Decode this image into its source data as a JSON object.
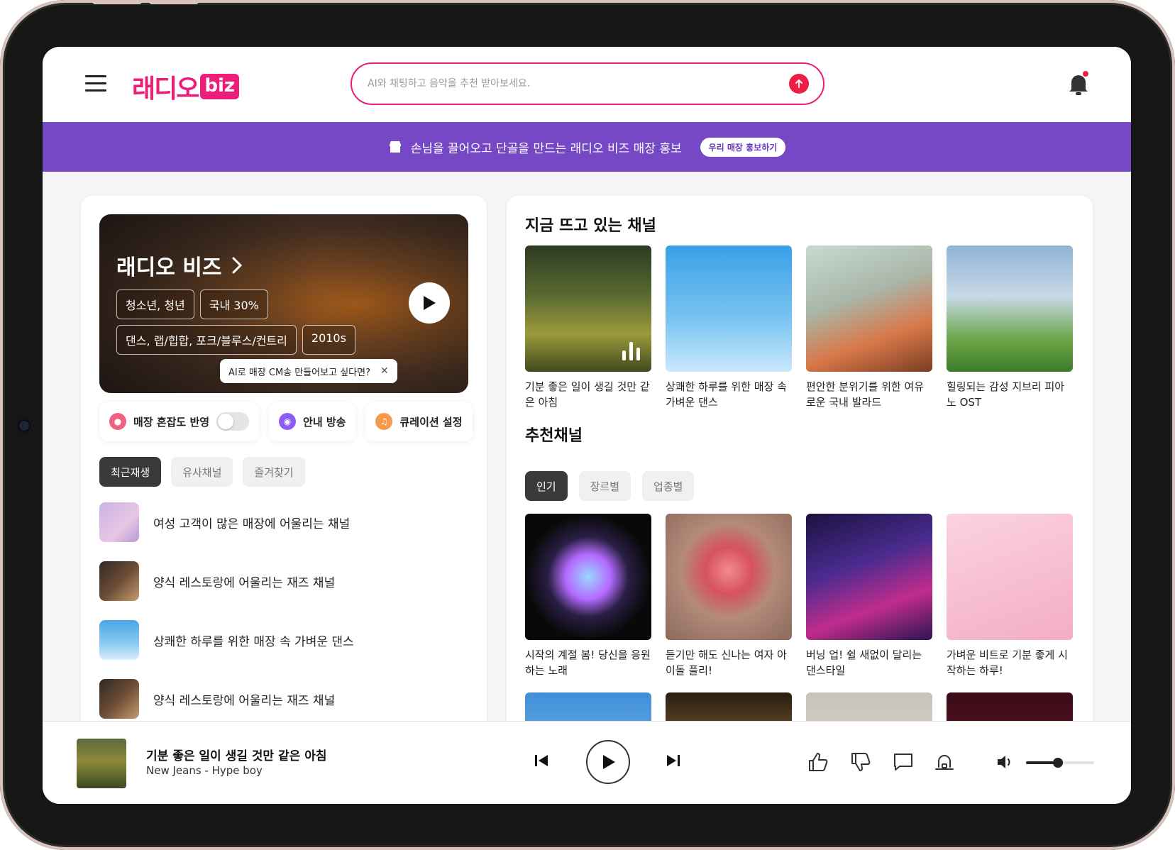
{
  "header": {
    "logo_text": "래디오",
    "logo_badge": "biz",
    "search_placeholder": "AI와 채팅하고 음악을 추천 받아보세요."
  },
  "banner": {
    "text": "손님을 끌어오고 단골을 만드는 래디오 비즈 매장 홍보",
    "button": "우리 매장 홍보하기"
  },
  "hero": {
    "title": "래디오 비즈",
    "chips_row1": [
      "청소년, 청년",
      "국내 30%"
    ],
    "chips_row2": [
      "댄스, 랩/힙합, 포크/블루스/컨트리",
      "2010s"
    ],
    "tooltip": "AI로 매장 CM송 만들어보고 싶다면?"
  },
  "controls": {
    "crowd": "매장 혼잡도 반영",
    "announce": "안내 방송",
    "curation": "큐레이션 설정",
    "crowd_toggle_on": false
  },
  "left_tabs": [
    "최근재생",
    "유사채널",
    "즐겨찾기"
  ],
  "recent_list": [
    "여성 고객이 많은 매장에 어울리는 채널",
    "양식 레스토랑에 어울리는 재즈 채널",
    "상쾌한 하루를 위한 매장 속 가벼운 댄스",
    "양식 레스토랑에 어울리는 재즈 채널"
  ],
  "trending": {
    "title": "지금 뜨고 있는 채널",
    "items": [
      "기분 좋은 일이 생길 것만 같은 아침",
      "상쾌한 하루를 위한 매장 속 가벼운 댄스",
      "편안한 분위기를 위한 여유로운 국내 발라드",
      "힐링되는 감성 지브리 피아노 OST"
    ]
  },
  "recommended": {
    "title": "추천채널",
    "tabs": [
      "인기",
      "장르별",
      "업종별"
    ],
    "items": [
      "시작의 계절 봄! 당신을 응원하는 노래",
      "듣기만 해도 신나는 여자 아이돌 플리!",
      "버닝 업! 쉴 새없이 달리는 댄스타일",
      "가벼운 비트로 기분 좋게 시작하는 하루!"
    ]
  },
  "player": {
    "title": "기분 좋은 일이 생길 것만 같은 아침",
    "artist": "New Jeans - Hype boy",
    "volume": 0.47
  },
  "colors": {
    "brand": "#ec1e79",
    "banner": "#7748c6",
    "send": "#ec1e43"
  }
}
